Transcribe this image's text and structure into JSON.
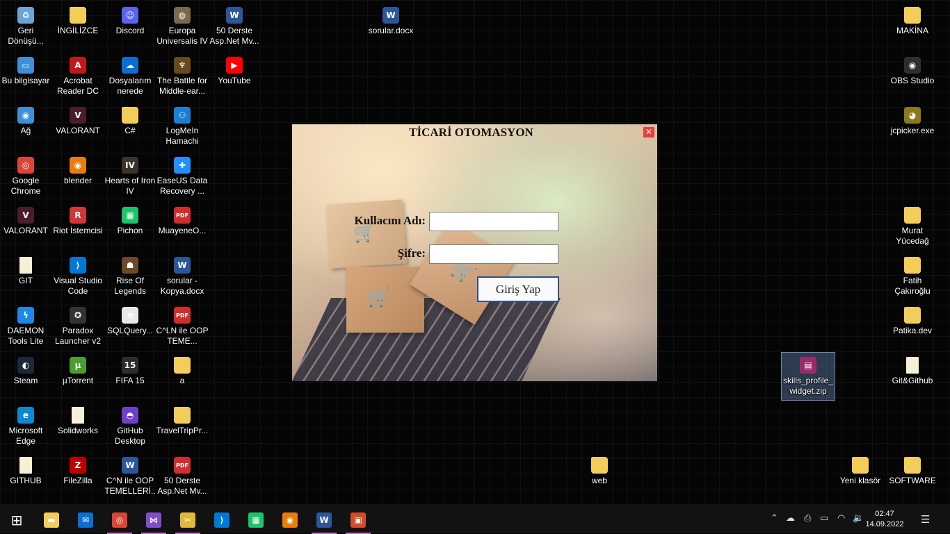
{
  "desktop": {
    "icons": [
      {
        "label": "Geri Dönüşü...",
        "icon": "recycle-bin-icon",
        "glyph": "♻",
        "color": "#6ea3d8"
      },
      {
        "label": "Bu bilgisayar",
        "icon": "computer-icon",
        "glyph": "▭",
        "color": "#3e8fd8"
      },
      {
        "label": "Ağ",
        "icon": "network-icon",
        "glyph": "◉",
        "color": "#3e8fd8"
      },
      {
        "label": "Google Chrome",
        "icon": "chrome-icon",
        "glyph": "◎",
        "color": "#db4437"
      },
      {
        "label": "VALORANT",
        "icon": "valorant-icon",
        "glyph": "V",
        "color": "#4a1d2a"
      },
      {
        "label": "GIT",
        "icon": "file-icon",
        "glyph": "",
        "color": "#f6f0d8"
      },
      {
        "label": "DAEMON Tools Lite",
        "icon": "daemon-tools-icon",
        "glyph": "ϟ",
        "color": "#1e88e5"
      },
      {
        "label": "Steam",
        "icon": "steam-icon",
        "glyph": "◐",
        "color": "#1b2838"
      },
      {
        "label": "Microsoft Edge",
        "icon": "edge-icon",
        "glyph": "e",
        "color": "#0c8ad1"
      },
      {
        "label": "GITHUB",
        "icon": "file-icon",
        "glyph": "",
        "color": "#f6f0d8"
      },
      {
        "label": "İNGİLİZCE",
        "icon": "folder-icon",
        "glyph": "",
        "color": "#f3cd5a"
      },
      {
        "label": "Acrobat Reader DC",
        "icon": "acrobat-icon",
        "glyph": "A",
        "color": "#c4161c"
      },
      {
        "label": "VALORANT",
        "icon": "valorant-icon",
        "glyph": "V",
        "color": "#4a1d2a"
      },
      {
        "label": "blender",
        "icon": "blender-icon",
        "glyph": "◉",
        "color": "#e87d0d"
      },
      {
        "label": "Riot İstemcisi",
        "icon": "riot-icon",
        "glyph": "R",
        "color": "#d13639"
      },
      {
        "label": "Visual Studio Code",
        "icon": "vscode-icon",
        "glyph": "⟩",
        "color": "#0078d4"
      },
      {
        "label": "Paradox Launcher v2",
        "icon": "paradox-icon",
        "glyph": "✪",
        "color": "#333"
      },
      {
        "label": "µTorrent",
        "icon": "utorrent-icon",
        "glyph": "µ",
        "color": "#4a9d2f"
      },
      {
        "label": "Solidworks",
        "icon": "file-icon",
        "glyph": "",
        "color": "#f6f0d8"
      },
      {
        "label": "FileZilla",
        "icon": "filezilla-icon",
        "glyph": "Z",
        "color": "#bf0000"
      },
      {
        "label": "Discord",
        "icon": "discord-icon",
        "glyph": "☺",
        "color": "#5865f2"
      },
      {
        "label": "Dosyalarım nerede",
        "icon": "onedrive-icon",
        "glyph": "☁",
        "color": "#0a6fd1"
      },
      {
        "label": "C#",
        "icon": "folder-icon",
        "glyph": "",
        "color": "#f3cd5a"
      },
      {
        "label": "Hearts of Iron IV",
        "icon": "hoi4-icon",
        "glyph": "IV",
        "color": "#3a342a"
      },
      {
        "label": "Pichon",
        "icon": "pichon-icon",
        "glyph": "▦",
        "color": "#1ec26b"
      },
      {
        "label": "Rise Of Legends",
        "icon": "rise-of-legends-icon",
        "glyph": "☗",
        "color": "#6b4a2a"
      },
      {
        "label": "SQLQuery...",
        "icon": "sql-file-icon",
        "glyph": "≡",
        "color": "#e8e8e8"
      },
      {
        "label": "FIFA 15",
        "icon": "fifa-icon",
        "glyph": "15",
        "color": "#2d2d2d"
      },
      {
        "label": "GitHub Desktop",
        "icon": "github-icon",
        "glyph": "◓",
        "color": "#6e40c9"
      },
      {
        "label": "C^N ile OOP TEMELLERİ...",
        "icon": "word-icon",
        "glyph": "W",
        "color": "#2b579a"
      },
      {
        "label": "Europa Universalis IV",
        "icon": "eu4-icon",
        "glyph": "◍",
        "color": "#7a6a4a"
      },
      {
        "label": "The Battle for Middle-ear...",
        "icon": "bfme-icon",
        "glyph": "♆",
        "color": "#6a4a1a"
      },
      {
        "label": "LogMeIn Hamachi",
        "icon": "hamachi-icon",
        "glyph": "⚇",
        "color": "#1a7fd0"
      },
      {
        "label": "EaseUS Data Recovery ...",
        "icon": "easeus-icon",
        "glyph": "✚",
        "color": "#1e90ff"
      },
      {
        "label": "MuayeneO...",
        "icon": "pdf-icon",
        "glyph": "PDF",
        "color": "#d22d2d"
      },
      {
        "label": "sorular - Kopya.docx",
        "icon": "word-icon",
        "glyph": "W",
        "color": "#2b579a"
      },
      {
        "label": "C^LN ile OOP TEME...",
        "icon": "pdf-icon",
        "glyph": "PDF",
        "color": "#d22d2d"
      },
      {
        "label": "a",
        "icon": "folder-icon",
        "glyph": "",
        "color": "#f3cd5a"
      },
      {
        "label": "TravelTripPr...",
        "icon": "folder-icon",
        "glyph": "",
        "color": "#f3cd5a"
      },
      {
        "label": "50 Derste Asp.Net Mv...",
        "icon": "pdf-icon",
        "glyph": "PDF",
        "color": "#d22d2d"
      },
      {
        "label": "50 Derste Asp.Net Mv...",
        "icon": "word-icon",
        "glyph": "W",
        "color": "#2b579a"
      },
      {
        "label": "YouTube",
        "icon": "youtube-icon",
        "glyph": "▶",
        "color": "#ff0000"
      },
      {
        "label": "sorular.docx",
        "icon": "word-icon",
        "glyph": "W",
        "color": "#2b579a"
      },
      {
        "label": "web",
        "icon": "folder-icon",
        "glyph": "",
        "color": "#f3cd5a"
      },
      {
        "label": "skills_profile_widget.zip",
        "icon": "zip-archive-icon",
        "glyph": "▤",
        "color": "#9b2a6a",
        "selected": true
      },
      {
        "label": "Yeni klasör",
        "icon": "folder-icon",
        "glyph": "",
        "color": "#f3cd5a"
      },
      {
        "label": "MAKİNA",
        "icon": "folder-icon",
        "glyph": "",
        "color": "#f3cd5a"
      },
      {
        "label": "OBS Studio",
        "icon": "obs-icon",
        "glyph": "◉",
        "color": "#302e31"
      },
      {
        "label": "jcpicker.exe",
        "icon": "jcpicker-icon",
        "glyph": "◕",
        "color": "#8a7a1a"
      },
      {
        "label": "Murat Yücedağ",
        "icon": "folder-icon",
        "glyph": "",
        "color": "#f3cd5a"
      },
      {
        "label": "Fatih Çakıroğlu",
        "icon": "folder-icon",
        "glyph": "",
        "color": "#f3cd5a"
      },
      {
        "label": "Patika.dev",
        "icon": "folder-icon",
        "glyph": "",
        "color": "#f3cd5a"
      },
      {
        "label": "Git&Github",
        "icon": "file-icon",
        "glyph": "",
        "color": "#f6f0d8"
      },
      {
        "label": "SOFTWARE",
        "icon": "folder-icon",
        "glyph": "",
        "color": "#f3cd5a"
      }
    ]
  },
  "window": {
    "title": "TİCARİ OTOMASYON",
    "close_glyph": "✕",
    "username_label": "Kullacını Adı:",
    "username_value": "",
    "password_label": "Şifre:",
    "password_value": "",
    "login_button": "Giriş Yap"
  },
  "taskbar": {
    "apps": [
      {
        "icon": "windows-start-icon",
        "glyph": "⊞",
        "color": "transparent",
        "running": false
      },
      {
        "icon": "file-explorer-icon",
        "glyph": "▬",
        "color": "#f3cd5a",
        "running": false
      },
      {
        "icon": "mail-icon",
        "glyph": "✉",
        "color": "#0a6fd1",
        "running": false
      },
      {
        "icon": "chrome-icon",
        "glyph": "◎",
        "color": "#db4437",
        "running": true
      },
      {
        "icon": "visual-studio-icon",
        "glyph": "⋈",
        "color": "#7e4fc9",
        "running": true
      },
      {
        "icon": "snipping-tool-icon",
        "glyph": "✂",
        "color": "#e0b83a",
        "running": true
      },
      {
        "icon": "vscode-icon",
        "glyph": "⟩",
        "color": "#0078d4",
        "running": false
      },
      {
        "icon": "pichon-icon",
        "glyph": "▦",
        "color": "#1ec26b",
        "running": false
      },
      {
        "icon": "blender-icon",
        "glyph": "◉",
        "color": "#e87d0d",
        "running": false
      },
      {
        "icon": "word-icon",
        "glyph": "W",
        "color": "#2b579a",
        "running": true
      },
      {
        "icon": "app-window-icon",
        "glyph": "▣",
        "color": "#d44a2a",
        "running": true
      }
    ],
    "tray": [
      {
        "icon": "chevron-up-icon",
        "glyph": "⌃"
      },
      {
        "icon": "cloud-sync-icon",
        "glyph": "☁"
      },
      {
        "icon": "meet-now-icon",
        "glyph": "⎙"
      },
      {
        "icon": "battery-icon",
        "glyph": "▭"
      },
      {
        "icon": "wifi-icon",
        "glyph": "◠"
      },
      {
        "icon": "volume-icon",
        "glyph": "🔉"
      }
    ],
    "time": "02:47",
    "date": "14.09.2022",
    "notification_glyph": "☰"
  }
}
